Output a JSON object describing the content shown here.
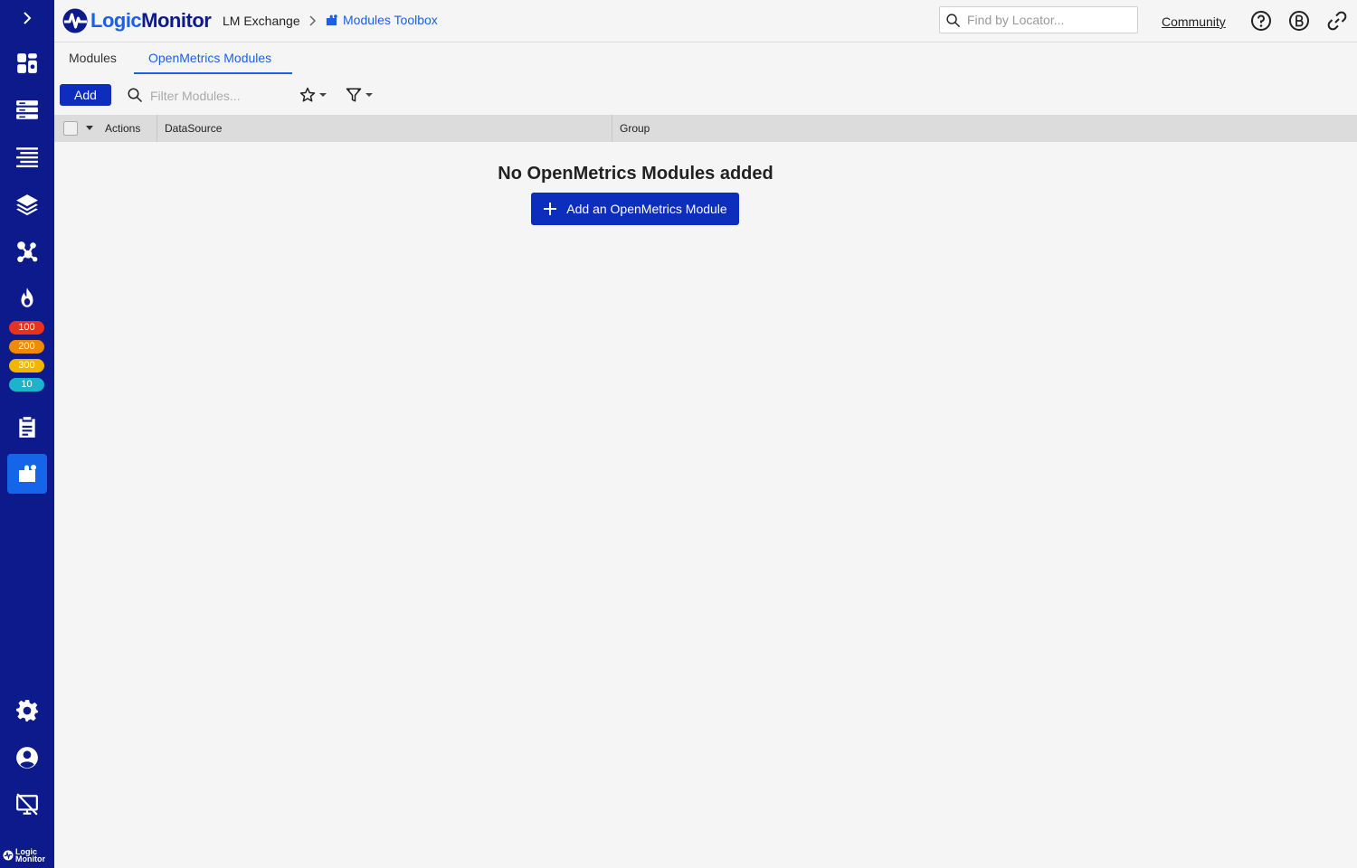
{
  "sidebar": {
    "alerts": {
      "critical": "100",
      "error": "200",
      "warning": "300",
      "other": "10"
    },
    "logo_text_1": "Logic",
    "logo_text_2": "Monitor"
  },
  "header": {
    "brand_part1": "Logic",
    "brand_part2": "Monitor",
    "exchange": "LM Exchange",
    "breadcrumb_current": "Modules Toolbox",
    "locator_placeholder": "Find by Locator...",
    "community": "Community"
  },
  "tabs": [
    {
      "label": "Modules",
      "active": false
    },
    {
      "label": "OpenMetrics Modules",
      "active": true
    }
  ],
  "toolbar": {
    "add_label": "Add",
    "filter_placeholder": "Filter Modules..."
  },
  "table": {
    "columns": [
      "Actions",
      "DataSource",
      "Group"
    ]
  },
  "empty_state": {
    "title": "No OpenMetrics Modules added",
    "button": "Add an OpenMetrics Module"
  },
  "colors": {
    "sidebar": "#0d1a8c",
    "accent": "#1a61e6",
    "primary_button": "#0d2dbd"
  }
}
